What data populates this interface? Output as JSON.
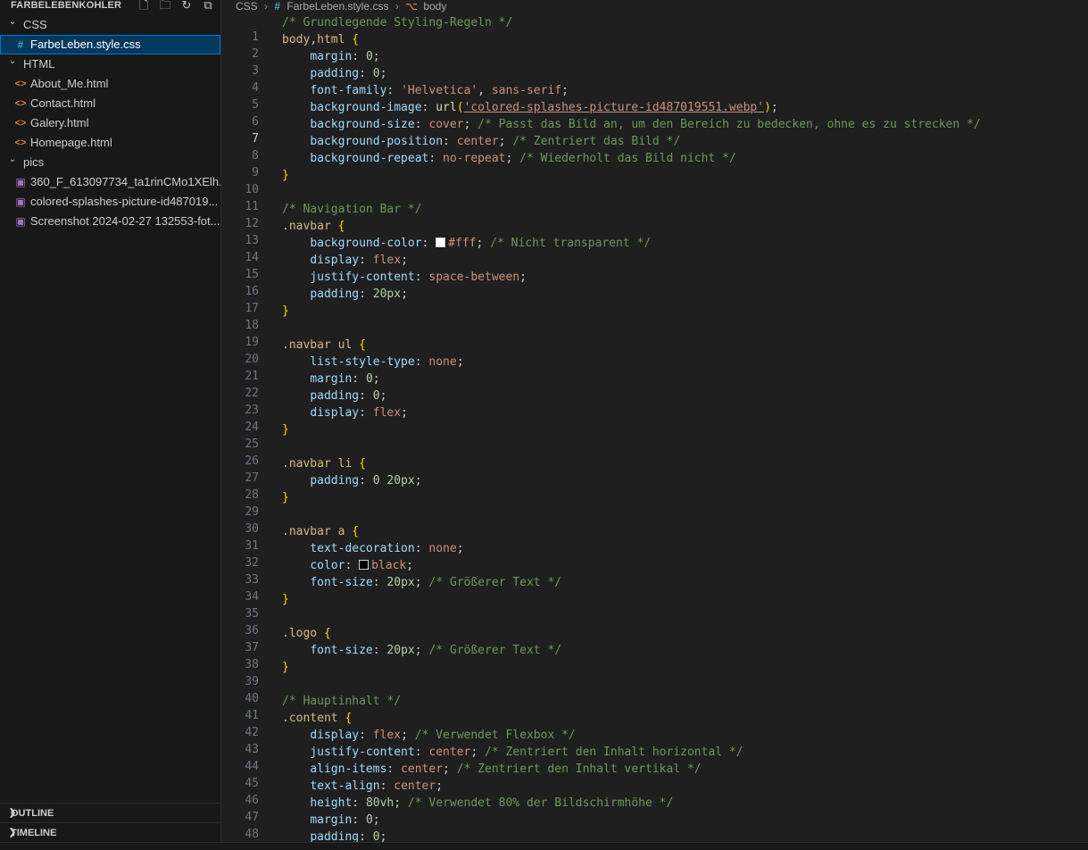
{
  "explorer": {
    "title": "FARBELEBENKOHLER",
    "tree": [
      {
        "type": "folder",
        "label": "CSS",
        "expanded": true,
        "depth": 0
      },
      {
        "type": "file",
        "label": "FarbeLeben.style.css",
        "icon": "css-hash-icon",
        "depth": 1,
        "selected": true
      },
      {
        "type": "folder",
        "label": "HTML",
        "expanded": true,
        "depth": 0
      },
      {
        "type": "file",
        "label": "About_Me.html",
        "icon": "html-icon",
        "depth": 1
      },
      {
        "type": "file",
        "label": "Contact.html",
        "icon": "html-icon",
        "depth": 1
      },
      {
        "type": "file",
        "label": "Galery.html",
        "icon": "html-icon",
        "depth": 1
      },
      {
        "type": "file",
        "label": "Homepage.html",
        "icon": "html-icon",
        "depth": 1
      },
      {
        "type": "folder",
        "label": "pics",
        "expanded": true,
        "depth": 0
      },
      {
        "type": "file",
        "label": "360_F_613097734_ta1rinCMo1XElh...",
        "icon": "image-icon",
        "depth": 1
      },
      {
        "type": "file",
        "label": "colored-splashes-picture-id487019...",
        "icon": "image-icon",
        "depth": 1
      },
      {
        "type": "file",
        "label": "Screenshot 2024-02-27 132553-fot...",
        "icon": "image-icon",
        "depth": 1
      }
    ],
    "panels": [
      "OUTLINE",
      "TIMELINE"
    ]
  },
  "breadcrumb": {
    "folder": "CSS",
    "file": "FarbeLeben.style.css",
    "symbol": "body"
  },
  "editor": {
    "active_line": 7,
    "lines": [
      [
        [
          "cm",
          "/* Grundlegende Styling-Regeln */"
        ]
      ],
      [
        [
          "sel",
          "body"
        ],
        [
          "",
          ","
        ],
        [
          "sel",
          "html"
        ],
        [
          "",
          " "
        ],
        [
          "p",
          "{"
        ]
      ],
      [
        [
          "",
          "    "
        ],
        [
          "prop",
          "margin"
        ],
        [
          "",
          ": "
        ],
        [
          "num",
          "0"
        ],
        [
          "",
          ";"
        ]
      ],
      [
        [
          "",
          "    "
        ],
        [
          "prop",
          "padding"
        ],
        [
          "",
          ": "
        ],
        [
          "num",
          "0"
        ],
        [
          "",
          ";"
        ]
      ],
      [
        [
          "",
          "    "
        ],
        [
          "prop",
          "font-family"
        ],
        [
          "",
          ": "
        ],
        [
          "val",
          "'Helvetica'"
        ],
        [
          "",
          ", "
        ],
        [
          "val",
          "sans-serif"
        ],
        [
          "",
          ";"
        ]
      ],
      [
        [
          "",
          "    "
        ],
        [
          "prop",
          "background-image"
        ],
        [
          "",
          ": "
        ],
        [
          "fn",
          "url"
        ],
        [
          "p",
          "("
        ],
        [
          "str",
          "'colored-splashes-picture-id487019551.webp'"
        ],
        [
          "p",
          ")"
        ],
        [
          "",
          ";"
        ]
      ],
      [
        [
          "",
          "    "
        ],
        [
          "prop",
          "background-size"
        ],
        [
          "",
          ": "
        ],
        [
          "val",
          "cover"
        ],
        [
          "",
          "; "
        ],
        [
          "cm",
          "/* Passt das Bild an, um den Bereich zu bedecken, ohne es zu strecken */"
        ]
      ],
      [
        [
          "",
          "    "
        ],
        [
          "prop",
          "background-position"
        ],
        [
          "",
          ": "
        ],
        [
          "val",
          "center"
        ],
        [
          "",
          "; "
        ],
        [
          "cm",
          "/* Zentriert das Bild */"
        ]
      ],
      [
        [
          "",
          "    "
        ],
        [
          "prop",
          "background-repeat"
        ],
        [
          "",
          ": "
        ],
        [
          "val",
          "no-repeat"
        ],
        [
          "",
          "; "
        ],
        [
          "cm",
          "/* Wiederholt das Bild nicht */"
        ]
      ],
      [
        [
          "p",
          "}"
        ]
      ],
      [],
      [
        [
          "cm",
          "/* Navigation Bar */"
        ]
      ],
      [
        [
          "sel",
          ".navbar"
        ],
        [
          "",
          " "
        ],
        [
          "p",
          "{"
        ]
      ],
      [
        [
          "",
          "    "
        ],
        [
          "prop",
          "background-color"
        ],
        [
          "",
          ": "
        ],
        [
          "sw",
          "#ffffff"
        ],
        [
          "val",
          "#fff"
        ],
        [
          "",
          "; "
        ],
        [
          "cm",
          "/* Nicht transparent */"
        ]
      ],
      [
        [
          "",
          "    "
        ],
        [
          "prop",
          "display"
        ],
        [
          "",
          ": "
        ],
        [
          "val",
          "flex"
        ],
        [
          "",
          ";"
        ]
      ],
      [
        [
          "",
          "    "
        ],
        [
          "prop",
          "justify-content"
        ],
        [
          "",
          ": "
        ],
        [
          "val",
          "space-between"
        ],
        [
          "",
          ";"
        ]
      ],
      [
        [
          "",
          "    "
        ],
        [
          "prop",
          "padding"
        ],
        [
          "",
          ": "
        ],
        [
          "num",
          "20px"
        ],
        [
          "",
          ";"
        ]
      ],
      [
        [
          "p",
          "}"
        ]
      ],
      [],
      [
        [
          "sel",
          ".navbar ul"
        ],
        [
          "",
          " "
        ],
        [
          "p",
          "{"
        ]
      ],
      [
        [
          "",
          "    "
        ],
        [
          "prop",
          "list-style-type"
        ],
        [
          "",
          ": "
        ],
        [
          "val",
          "none"
        ],
        [
          "",
          ";"
        ]
      ],
      [
        [
          "",
          "    "
        ],
        [
          "prop",
          "margin"
        ],
        [
          "",
          ": "
        ],
        [
          "num",
          "0"
        ],
        [
          "",
          ";"
        ]
      ],
      [
        [
          "",
          "    "
        ],
        [
          "prop",
          "padding"
        ],
        [
          "",
          ": "
        ],
        [
          "num",
          "0"
        ],
        [
          "",
          ";"
        ]
      ],
      [
        [
          "",
          "    "
        ],
        [
          "prop",
          "display"
        ],
        [
          "",
          ": "
        ],
        [
          "val",
          "flex"
        ],
        [
          "",
          ";"
        ]
      ],
      [
        [
          "p",
          "}"
        ]
      ],
      [],
      [
        [
          "sel",
          ".navbar li"
        ],
        [
          "",
          " "
        ],
        [
          "p",
          "{"
        ]
      ],
      [
        [
          "",
          "    "
        ],
        [
          "prop",
          "padding"
        ],
        [
          "",
          ": "
        ],
        [
          "num",
          "0 20px"
        ],
        [
          "",
          ";"
        ]
      ],
      [
        [
          "p",
          "}"
        ]
      ],
      [],
      [
        [
          "sel",
          ".navbar a"
        ],
        [
          "",
          " "
        ],
        [
          "p",
          "{"
        ]
      ],
      [
        [
          "",
          "    "
        ],
        [
          "prop",
          "text-decoration"
        ],
        [
          "",
          ": "
        ],
        [
          "val",
          "none"
        ],
        [
          "",
          ";"
        ]
      ],
      [
        [
          "",
          "    "
        ],
        [
          "prop",
          "color"
        ],
        [
          "",
          ": "
        ],
        [
          "sw",
          "#000000"
        ],
        [
          "val",
          "black"
        ],
        [
          "",
          ";"
        ]
      ],
      [
        [
          "",
          "    "
        ],
        [
          "prop",
          "font-size"
        ],
        [
          "",
          ": "
        ],
        [
          "num",
          "20px"
        ],
        [
          "",
          "; "
        ],
        [
          "cm",
          "/* Größerer Text */"
        ]
      ],
      [
        [
          "p",
          "}"
        ]
      ],
      [],
      [
        [
          "sel",
          ".logo"
        ],
        [
          "",
          " "
        ],
        [
          "p",
          "{"
        ]
      ],
      [
        [
          "",
          "    "
        ],
        [
          "prop",
          "font-size"
        ],
        [
          "",
          ": "
        ],
        [
          "num",
          "20px"
        ],
        [
          "",
          "; "
        ],
        [
          "cm",
          "/* Größerer Text */"
        ]
      ],
      [
        [
          "p",
          "}"
        ]
      ],
      [],
      [
        [
          "cm",
          "/* Hauptinhalt */"
        ]
      ],
      [
        [
          "sel",
          ".content"
        ],
        [
          "",
          " "
        ],
        [
          "p",
          "{"
        ]
      ],
      [
        [
          "",
          "    "
        ],
        [
          "prop",
          "display"
        ],
        [
          "",
          ": "
        ],
        [
          "val",
          "flex"
        ],
        [
          "",
          "; "
        ],
        [
          "cm",
          "/* Verwendet Flexbox */"
        ]
      ],
      [
        [
          "",
          "    "
        ],
        [
          "prop",
          "justify-content"
        ],
        [
          "",
          ": "
        ],
        [
          "val",
          "center"
        ],
        [
          "",
          "; "
        ],
        [
          "cm",
          "/* Zentriert den Inhalt horizontal */"
        ]
      ],
      [
        [
          "",
          "    "
        ],
        [
          "prop",
          "align-items"
        ],
        [
          "",
          ": "
        ],
        [
          "val",
          "center"
        ],
        [
          "",
          "; "
        ],
        [
          "cm",
          "/* Zentriert den Inhalt vertikal */"
        ]
      ],
      [
        [
          "",
          "    "
        ],
        [
          "prop",
          "text-align"
        ],
        [
          "",
          ": "
        ],
        [
          "val",
          "center"
        ],
        [
          "",
          ";"
        ]
      ],
      [
        [
          "",
          "    "
        ],
        [
          "prop",
          "height"
        ],
        [
          "",
          ": "
        ],
        [
          "num",
          "80vh"
        ],
        [
          "",
          "; "
        ],
        [
          "cm",
          "/* Verwendet 80% der Bildschirmhöhe */"
        ]
      ],
      [
        [
          "",
          "    "
        ],
        [
          "prop",
          "margin"
        ],
        [
          "",
          ": "
        ],
        [
          "num",
          "0"
        ],
        [
          "",
          ";"
        ]
      ],
      [
        [
          "",
          "    "
        ],
        [
          "prop",
          "padding"
        ],
        [
          "",
          ": "
        ],
        [
          "num",
          "0"
        ],
        [
          "",
          ";"
        ]
      ]
    ]
  },
  "colors": {
    "sidebar_bg": "#181818",
    "editor_bg": "#1f1f1f",
    "selection": "#04395e",
    "focus_border": "#0078d4"
  }
}
